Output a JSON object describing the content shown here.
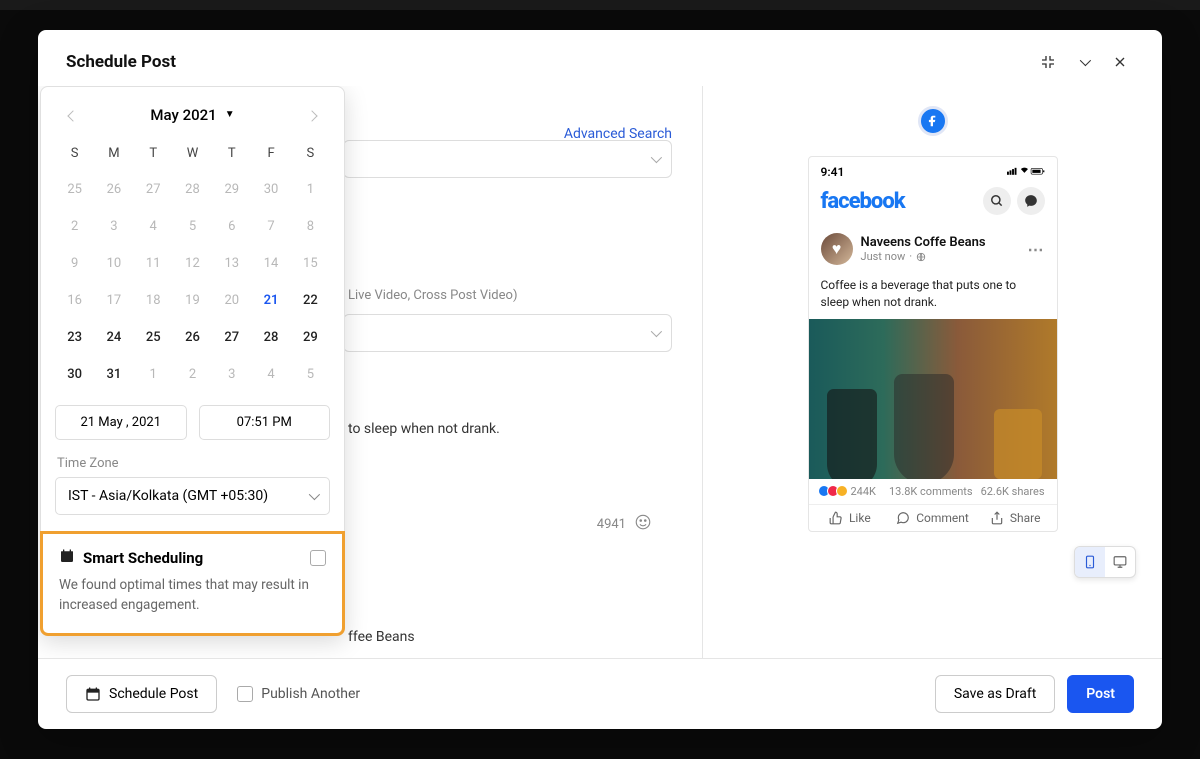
{
  "modal": {
    "title": "Schedule Post"
  },
  "header_actions": {
    "collapse_icon": "collapse",
    "expand_icon": "expand",
    "close_icon": "close"
  },
  "left": {
    "advanced_search": "Advanced Search",
    "video_hint": "Live Video, Cross Post Video)",
    "content_text": "to sleep when not drank.",
    "char_count": "4941",
    "coffee_label": "ffee Beans"
  },
  "calendar": {
    "month": "May 2021",
    "dow": [
      "S",
      "M",
      "T",
      "W",
      "T",
      "F",
      "S"
    ],
    "cells": [
      {
        "n": "25",
        "cls": ""
      },
      {
        "n": "26",
        "cls": ""
      },
      {
        "n": "27",
        "cls": ""
      },
      {
        "n": "28",
        "cls": ""
      },
      {
        "n": "29",
        "cls": ""
      },
      {
        "n": "30",
        "cls": ""
      },
      {
        "n": "1",
        "cls": ""
      },
      {
        "n": "2",
        "cls": ""
      },
      {
        "n": "3",
        "cls": ""
      },
      {
        "n": "4",
        "cls": ""
      },
      {
        "n": "5",
        "cls": ""
      },
      {
        "n": "6",
        "cls": ""
      },
      {
        "n": "7",
        "cls": ""
      },
      {
        "n": "8",
        "cls": ""
      },
      {
        "n": "9",
        "cls": ""
      },
      {
        "n": "10",
        "cls": ""
      },
      {
        "n": "11",
        "cls": ""
      },
      {
        "n": "12",
        "cls": ""
      },
      {
        "n": "13",
        "cls": ""
      },
      {
        "n": "14",
        "cls": ""
      },
      {
        "n": "15",
        "cls": ""
      },
      {
        "n": "16",
        "cls": ""
      },
      {
        "n": "17",
        "cls": ""
      },
      {
        "n": "18",
        "cls": ""
      },
      {
        "n": "19",
        "cls": ""
      },
      {
        "n": "20",
        "cls": ""
      },
      {
        "n": "21",
        "cls": "sel"
      },
      {
        "n": "22",
        "cls": "cur"
      },
      {
        "n": "23",
        "cls": "cur"
      },
      {
        "n": "24",
        "cls": "cur"
      },
      {
        "n": "25",
        "cls": "cur"
      },
      {
        "n": "26",
        "cls": "cur"
      },
      {
        "n": "27",
        "cls": "cur"
      },
      {
        "n": "28",
        "cls": "cur"
      },
      {
        "n": "29",
        "cls": "cur"
      },
      {
        "n": "30",
        "cls": "cur"
      },
      {
        "n": "31",
        "cls": "cur"
      },
      {
        "n": "1",
        "cls": ""
      },
      {
        "n": "2",
        "cls": ""
      },
      {
        "n": "3",
        "cls": ""
      },
      {
        "n": "4",
        "cls": ""
      },
      {
        "n": "5",
        "cls": ""
      }
    ],
    "date_value": "21 May , 2021",
    "time_value": "07:51 PM",
    "tz_label": "Time Zone",
    "tz_value": "IST - Asia/Kolkata (GMT +05:30)",
    "smart": {
      "title": "Smart Scheduling",
      "desc": "We found optimal times that may result in increased engagement."
    }
  },
  "preview": {
    "clock": "9:41",
    "logo": "facebook",
    "page_name": "Naveens Coffe Beans",
    "post_time": "Just now",
    "post_text": "Coffee is a beverage that puts one to sleep when not drank.",
    "reactions": "244K",
    "comments": "13.8K comments",
    "shares": "62.6K shares",
    "like": "Like",
    "comment": "Comment",
    "share": "Share"
  },
  "footer": {
    "schedule_post": "Schedule Post",
    "publish_another": "Publish Another",
    "save_draft": "Save as Draft",
    "post": "Post"
  }
}
